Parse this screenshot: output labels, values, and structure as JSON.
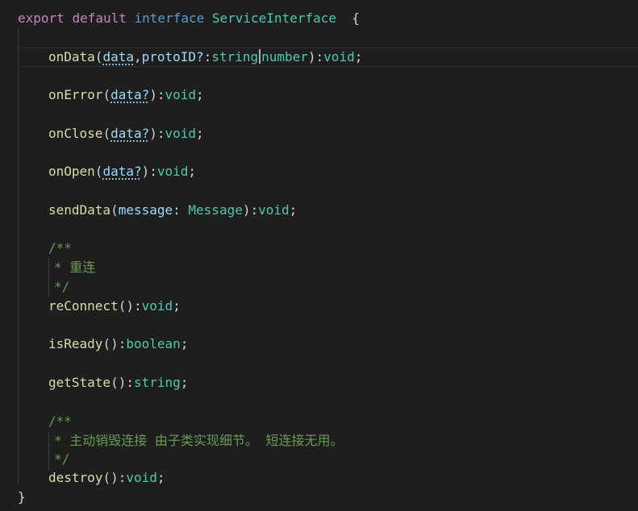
{
  "code": {
    "header": {
      "export": "export",
      "default": "default",
      "interface": "interface",
      "name": "ServiceInterface",
      "brace": "{"
    },
    "onData": {
      "fn": "onData",
      "p1": "data",
      "p2": "protoID?",
      "t1": "string",
      "t2": "number",
      "ret": "void"
    },
    "onError": {
      "fn": "onError",
      "p": "data?",
      "ret": "void"
    },
    "onClose": {
      "fn": "onClose",
      "p": "data?",
      "ret": "void"
    },
    "onOpen": {
      "fn": "onOpen",
      "p": "data?",
      "ret": "void"
    },
    "sendData": {
      "fn": "sendData",
      "p": "message",
      "t": "Message",
      "ret": "void"
    },
    "comment1": {
      "open": "/**",
      "body": "* 重连",
      "close": "*/"
    },
    "reConnect": {
      "fn": "reConnect",
      "ret": "void"
    },
    "isReady": {
      "fn": "isReady",
      "ret": "boolean"
    },
    "getState": {
      "fn": "getState",
      "ret": "string"
    },
    "comment2": {
      "open": "/**",
      "body": "* 主动销毁连接 由子类实现细节。 短连接无用。",
      "close": "*/"
    },
    "destroy": {
      "fn": "destroy",
      "ret": "void"
    },
    "closing_brace": "}"
  }
}
